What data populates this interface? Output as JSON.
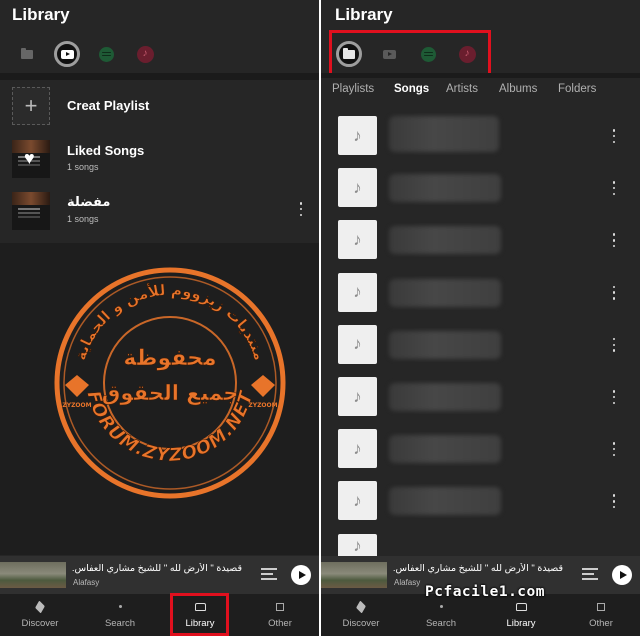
{
  "left_screen": {
    "title": "Library",
    "sources": [
      {
        "icon": "folder-icon",
        "active": false
      },
      {
        "icon": "youtube-icon",
        "active": true
      },
      {
        "icon": "spotify-icon",
        "active": false
      },
      {
        "icon": "apple-music-icon",
        "active": false
      }
    ],
    "create_playlist": {
      "icon": "plus-icon",
      "plus_glyph": "+",
      "label": "Creat Playlist"
    },
    "playlists": [
      {
        "name": "Liked Songs",
        "count": "1 songs",
        "has_menu": false
      },
      {
        "name": "مفضلة",
        "count": "1 songs",
        "has_menu": true
      }
    ]
  },
  "right_screen": {
    "title": "Library",
    "sources": [
      {
        "icon": "folder-icon",
        "active": true
      },
      {
        "icon": "youtube-icon",
        "active": false
      },
      {
        "icon": "spotify-icon",
        "active": false
      },
      {
        "icon": "apple-music-icon",
        "active": false
      }
    ],
    "tabs": [
      "Playlists",
      "Songs",
      "Artists",
      "Albums",
      "Folders"
    ],
    "active_tab": "Songs",
    "song_count_visible": 9,
    "music_note_glyph": "♪"
  },
  "mini_player": {
    "title": "قصيدة \" الأرض لله \" للشيخ مشاري العفاس..",
    "artist": "Alafasy"
  },
  "bottom_nav": [
    {
      "label": "Discover",
      "icon": "compass-icon"
    },
    {
      "label": "Search",
      "icon": "search-icon"
    },
    {
      "label": "Library",
      "icon": "library-icon",
      "active": true
    },
    {
      "label": "Other",
      "icon": "other-icon"
    }
  ],
  "watermarks": {
    "site": "Pcfacile1.com",
    "stamp_lines": [
      "منتديات زيزووم للأمن و الحماية",
      "محفوظة",
      "جميع الحقوق",
      "FORUM.ZYZOOM.NET",
      "ZYZOOM"
    ]
  },
  "colors": {
    "background": "#262626",
    "highlight_red": "#e0101e",
    "stamp_orange": "#e8742a"
  }
}
